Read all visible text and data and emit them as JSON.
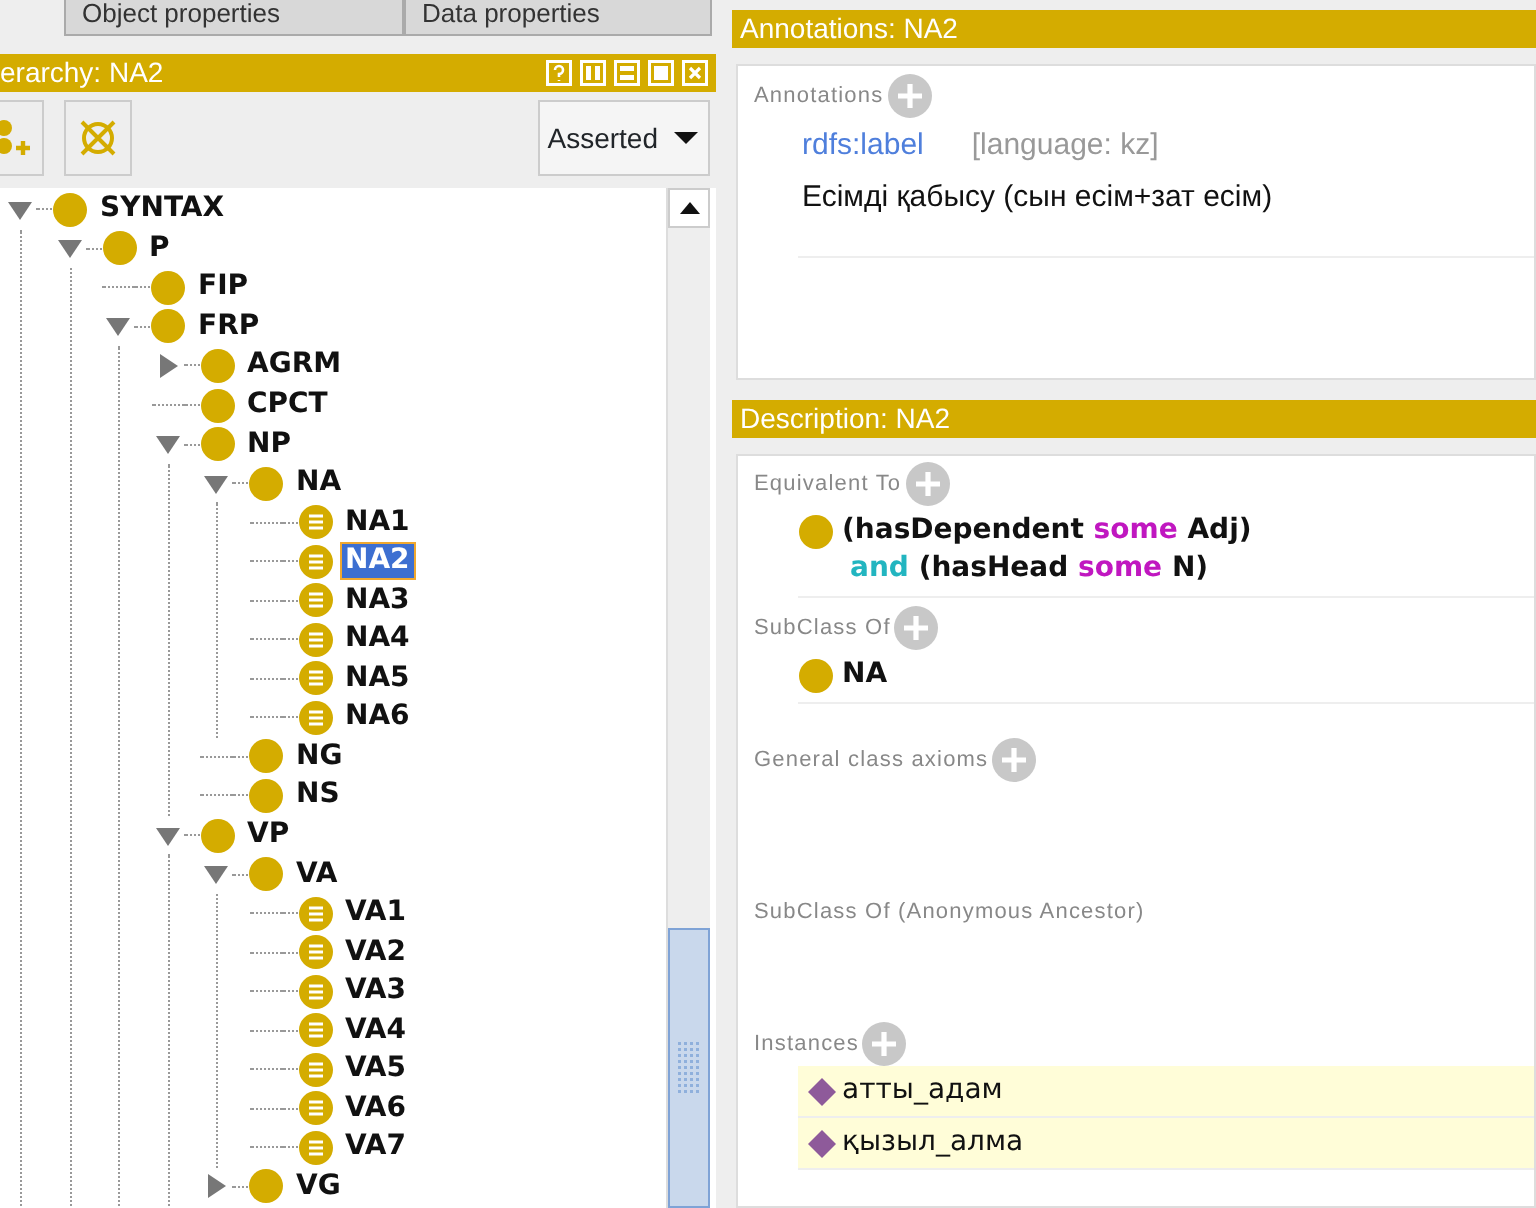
{
  "left_panel": {
    "tabs": [
      "Object properties",
      "Data properties"
    ],
    "title": "erarchy: NA2",
    "toolbar": {
      "dropdown": "Asserted"
    },
    "tree": [
      {
        "label": "SYNTAX",
        "kind": "class",
        "expanded": true,
        "selected": false,
        "children": [
          {
            "label": "P",
            "kind": "class",
            "expanded": true,
            "selected": false,
            "children": [
              {
                "label": "FIP",
                "kind": "class",
                "selected": false
              },
              {
                "label": "FRP",
                "kind": "class",
                "expanded": true,
                "selected": false,
                "children": [
                  {
                    "label": "AGRM",
                    "kind": "class",
                    "expanded": false,
                    "selected": false
                  },
                  {
                    "label": "CPCT",
                    "kind": "class",
                    "selected": false
                  },
                  {
                    "label": "NP",
                    "kind": "class",
                    "expanded": true,
                    "selected": false,
                    "children": [
                      {
                        "label": "NA",
                        "kind": "class",
                        "expanded": true,
                        "selected": false,
                        "children": [
                          {
                            "label": "NA1",
                            "kind": "defined",
                            "selected": false
                          },
                          {
                            "label": "NA2",
                            "kind": "defined",
                            "selected": true
                          },
                          {
                            "label": "NA3",
                            "kind": "defined",
                            "selected": false
                          },
                          {
                            "label": "NA4",
                            "kind": "defined",
                            "selected": false
                          },
                          {
                            "label": "NA5",
                            "kind": "defined",
                            "selected": false
                          },
                          {
                            "label": "NA6",
                            "kind": "defined",
                            "selected": false
                          }
                        ]
                      },
                      {
                        "label": "NG",
                        "kind": "class",
                        "selected": false
                      },
                      {
                        "label": "NS",
                        "kind": "class",
                        "selected": false
                      }
                    ]
                  },
                  {
                    "label": "VP",
                    "kind": "class",
                    "expanded": true,
                    "selected": false,
                    "children": [
                      {
                        "label": "VA",
                        "kind": "class",
                        "expanded": true,
                        "selected": false,
                        "children": [
                          {
                            "label": "VA1",
                            "kind": "defined",
                            "selected": false
                          },
                          {
                            "label": "VA2",
                            "kind": "defined",
                            "selected": false
                          },
                          {
                            "label": "VA3",
                            "kind": "defined",
                            "selected": false
                          },
                          {
                            "label": "VA4",
                            "kind": "defined",
                            "selected": false
                          },
                          {
                            "label": "VA5",
                            "kind": "defined",
                            "selected": false
                          },
                          {
                            "label": "VA6",
                            "kind": "defined",
                            "selected": false
                          },
                          {
                            "label": "VA7",
                            "kind": "defined",
                            "selected": false
                          }
                        ]
                      },
                      {
                        "label": "VG",
                        "kind": "class",
                        "expanded": false,
                        "selected": false
                      }
                    ]
                  }
                ]
              }
            ]
          }
        ]
      }
    ]
  },
  "annotations_panel": {
    "title": "Annotations: NA2",
    "section": "Annotations",
    "items": [
      {
        "property": "rdfs:label",
        "language": "[language: kz]",
        "value": "Есімді қабысу (сын есім+зат есім)"
      }
    ]
  },
  "description_panel": {
    "title": "Description: NA2",
    "sections": [
      {
        "label": "Equivalent To",
        "addable": true,
        "items": [
          {
            "kind": "expression",
            "lines": [
              [
                {
                  "text": "(hasDependent",
                  "kind": "name"
                },
                {
                  "text": "some",
                  "kind": "keyword"
                },
                {
                  "text": "Adj)",
                  "kind": "name"
                }
              ],
              [
                {
                  "text": "and",
                  "kind": "connective"
                },
                {
                  "text": "(hasHead",
                  "kind": "name"
                },
                {
                  "text": "some",
                  "kind": "keyword"
                },
                {
                  "text": "N)",
                  "kind": "name"
                }
              ]
            ]
          }
        ]
      },
      {
        "label": "SubClass Of",
        "addable": true,
        "items": [
          {
            "kind": "class",
            "text": "NA"
          }
        ]
      },
      {
        "label": "General class axioms",
        "addable": true
      },
      {
        "label": "SubClass Of (Anonymous Ancestor)",
        "addable": false
      },
      {
        "label": "Instances",
        "addable": true,
        "items": [
          {
            "kind": "individual",
            "text": "атты_адам"
          },
          {
            "kind": "individual",
            "text": "қызыл_алма"
          }
        ]
      }
    ]
  }
}
